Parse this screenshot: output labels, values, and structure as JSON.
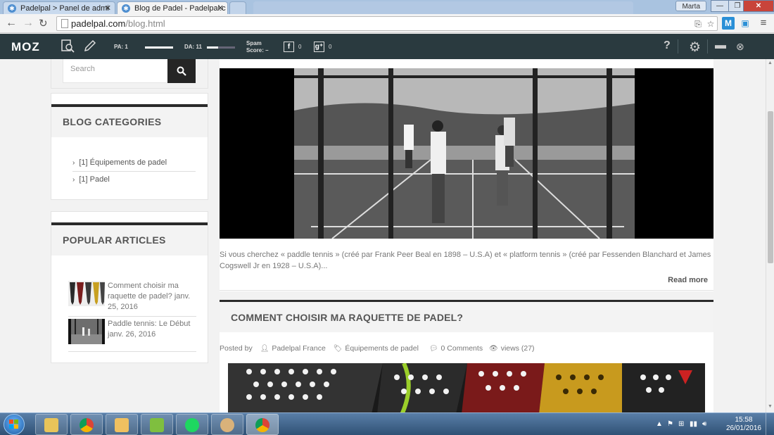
{
  "browser": {
    "tabs": [
      {
        "title": "Padelpal > Panel de admi",
        "active": false
      },
      {
        "title": "Blog de Padel - Padelpal.c",
        "active": true
      }
    ],
    "user": "Marta",
    "url_host": "padelpal.com",
    "url_path": "/blog.html"
  },
  "mozbar": {
    "logo": "MOZ",
    "pa_label": "PA: 1",
    "da_label": "DA: 11",
    "spam_label_1": "Spam",
    "spam_label_2": "Score:",
    "spam_value": "–",
    "facebook_count": "0",
    "google_count": "0",
    "help": "?",
    "pa_level": 0.01,
    "da_level": 0.11
  },
  "sidebar": {
    "search_placeholder": "Search",
    "categories_title": "BLOG CATEGORIES",
    "categories": [
      "[1] Équipements de padel",
      "[1] Padel"
    ],
    "popular_title": "POPULAR ARTICLES",
    "popular": [
      {
        "title": "Comment choisir ma raquette de padel?",
        "date": "janv. 25, 2016"
      },
      {
        "title": "Paddle tennis: Le Début",
        "date": "janv. 26, 2016"
      }
    ]
  },
  "post1": {
    "excerpt": "Si vous cherchez « paddle tennis » (créé par Frank Peer Beal en 1898 – U.S.A) et « platform tennis » (créé par Fessenden Blanchard et James Cogswell Jr en 1928 – U.S.A)...",
    "read_more": "Read more"
  },
  "post2": {
    "title": "COMMENT CHOISIR MA RAQUETTE DE PADEL?",
    "posted_by_label": "Posted by",
    "author": "Padelpal France",
    "category": "Équipements de padel",
    "comments": "0 Comments",
    "views": "views (27)"
  },
  "taskbar": {
    "time": "15:58",
    "date": "26/01/2016"
  },
  "colors": {
    "mozbar_bg": "#2a3a3f",
    "accent_dark": "#252525",
    "taskbar": "#2f5175"
  }
}
